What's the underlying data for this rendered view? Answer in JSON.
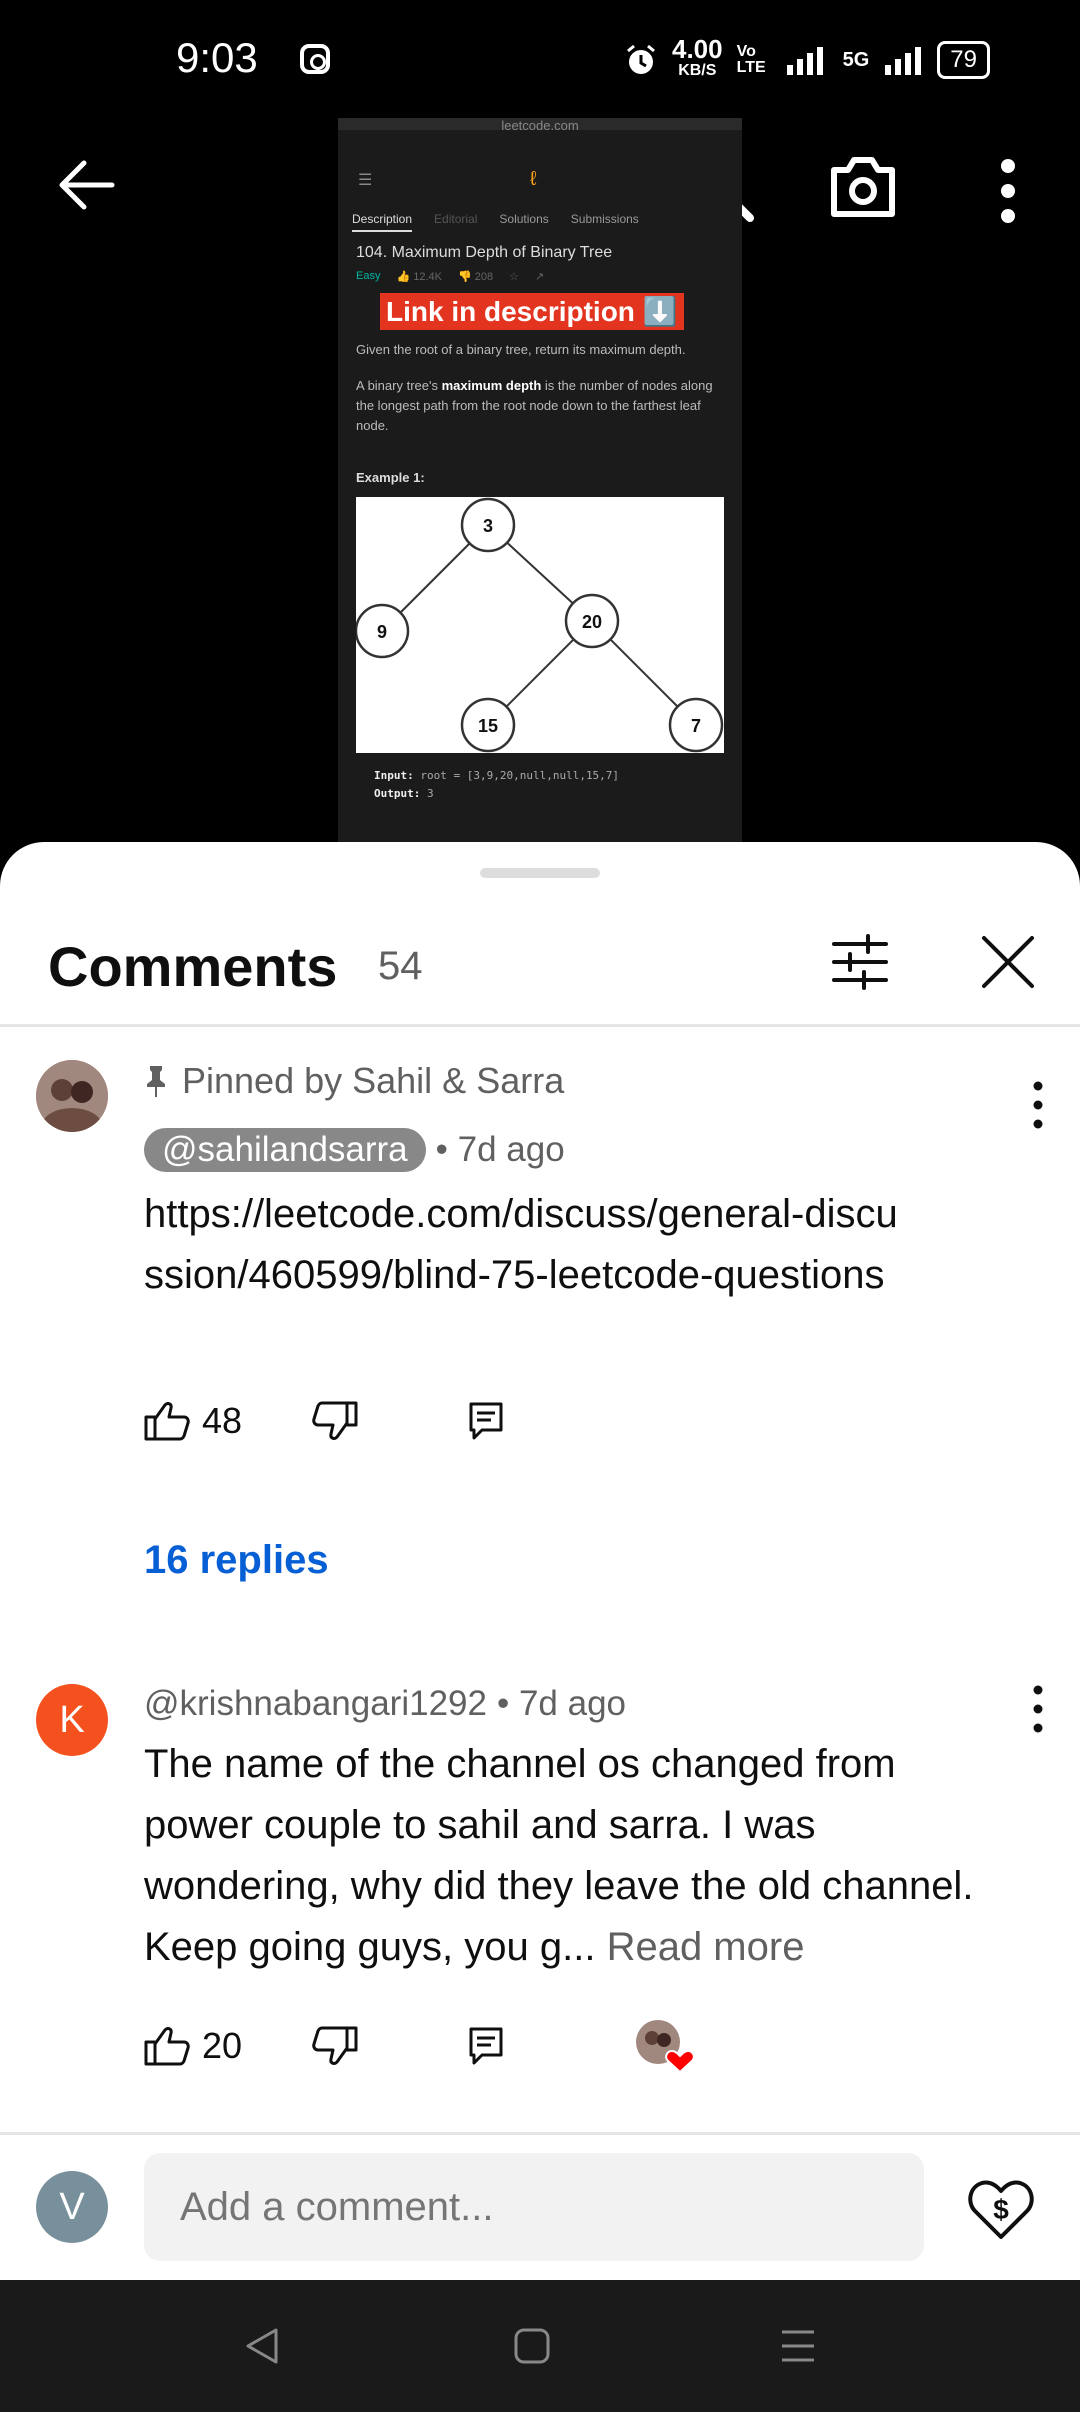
{
  "status_bar": {
    "time": "9:03",
    "speed_value": "4.00",
    "speed_unit": "KB/S",
    "volte": "Vo LTE",
    "network": "5G",
    "battery": "79"
  },
  "video": {
    "url": "leetcode.com",
    "tabs": [
      "Description",
      "Editorial",
      "Solutions",
      "Submissions"
    ],
    "problem_title": "104. Maximum Depth of Binary Tree",
    "difficulty": "Easy",
    "likes": "12.4K",
    "dislikes": "208",
    "banner": "Link in description ⬇️",
    "desc_1": "Given the root of a binary tree, return its maximum depth.",
    "desc_2_bold": "maximum depth",
    "desc_2_pre": "A binary tree's ",
    "desc_2_post": " is the number of nodes along the longest path from the root node down to the farthest leaf node.",
    "example_label": "Example 1:",
    "tree_nodes": [
      "3",
      "9",
      "20",
      "15",
      "7"
    ],
    "input_label": "Input:",
    "input_value": "root = [3,9,20,null,null,15,7]",
    "output_label": "Output:",
    "output_value": "3"
  },
  "comments_sheet": {
    "title": "Comments",
    "count": "54",
    "comments": [
      {
        "pinned_text": "Pinned by Sahil & Sarra",
        "author": "@sahilandsarra",
        "time": "• 7d ago",
        "text": "https://leetcode.com/discuss/general-discussion/460599/blind-75-leetcode-questions",
        "likes": "48",
        "replies": "16 replies"
      },
      {
        "avatar_letter": "K",
        "author": "@krishnabangari1292",
        "time": "• 7d ago",
        "text": "The name of the channel os changed from power couple to sahil and sarra. I was wondering, why did they leave the old channel. Keep going guys, you g...",
        "read_more": "Read more",
        "likes": "20"
      }
    ],
    "add_comment_placeholder": "Add a comment...",
    "user_avatar_letter": "V"
  },
  "colors": {
    "accent_link": "#065fd4",
    "banner_red": "#e3341f",
    "k_avatar": "#f4511e",
    "v_avatar": "#78909c",
    "heart_red": "#ff0000"
  }
}
